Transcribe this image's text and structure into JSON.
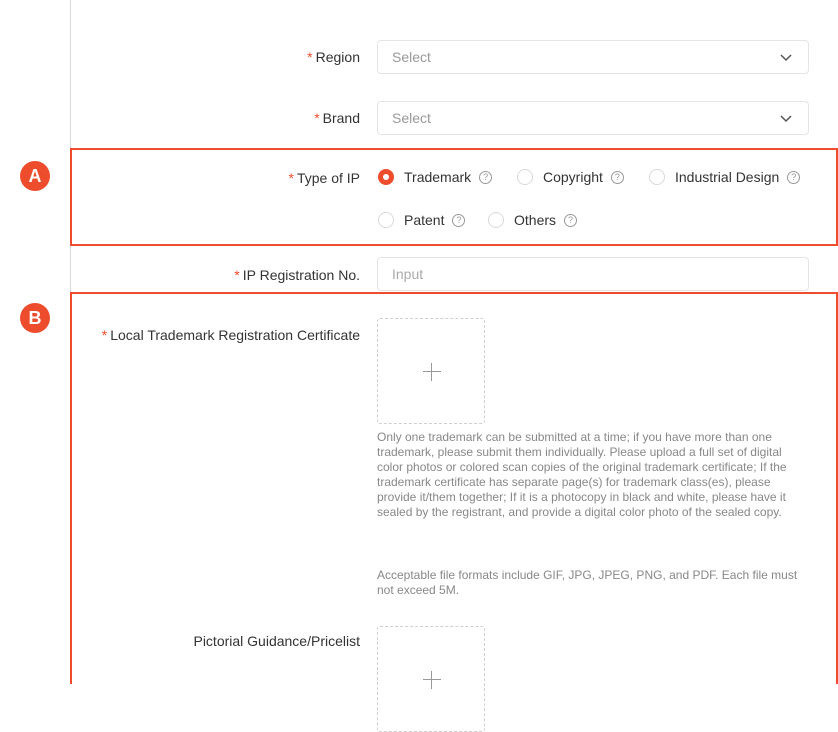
{
  "colors": {
    "accent": "#ee4d2d"
  },
  "form": {
    "required_mark": "*",
    "region": {
      "label": "Region",
      "placeholder": "Select"
    },
    "brand": {
      "label": "Brand",
      "placeholder": "Select"
    },
    "type_of_ip": {
      "label": "Type of IP",
      "options": [
        {
          "label": "Trademark",
          "selected": true
        },
        {
          "label": "Copyright",
          "selected": false
        },
        {
          "label": "Industrial Design",
          "selected": false
        },
        {
          "label": "Patent",
          "selected": false
        },
        {
          "label": "Others",
          "selected": false
        }
      ],
      "help_glyph": "?"
    },
    "ip_registration_no": {
      "label": "IP Registration No.",
      "placeholder": "Input"
    },
    "local_trademark_cert": {
      "label": "Local Trademark Registration Certificate",
      "hint_1": "Only one trademark can be submitted at a time; if you have more than one trademark, please submit them individually. Please upload a full set of digital color photos or colored scan copies of the original trademark certificate; If the trademark certificate has separate page(s) for trademark class(es), please provide it/them together; If it is a photocopy in black and white, please have it sealed by the registrant, and provide a digital color photo of the sealed copy.",
      "hint_2": "Acceptable file formats include GIF, JPG, JPEG, PNG, and PDF. Each file must not exceed 5M."
    },
    "pictorial_guidance": {
      "label": "Pictorial Guidance/Pricelist"
    }
  },
  "annotations": {
    "a": "A",
    "b": "B"
  }
}
